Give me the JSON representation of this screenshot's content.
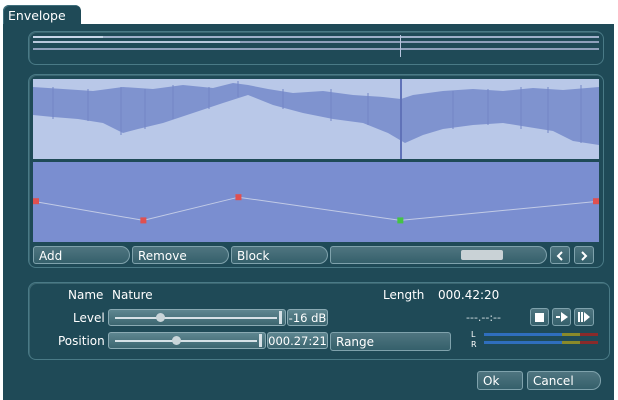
{
  "tab": {
    "label": "Envelope"
  },
  "buttons": {
    "add": "Add",
    "remove": "Remove",
    "block": "Block",
    "range": "Range",
    "ok": "Ok",
    "cancel": "Cancel"
  },
  "info": {
    "name_label": "Name",
    "name_value": "Nature",
    "length_label": "Length",
    "length_value": "000.42:20",
    "time_display": "---.--:--"
  },
  "controls": {
    "level_label": "Level",
    "level_value": "-16 dB",
    "level_fraction": 0.27,
    "position_label": "Position",
    "position_value": "000.27:21",
    "position_fraction": 0.43
  },
  "meters": {
    "left_label": "L",
    "right_label": "R"
  },
  "envelope": {
    "points": [
      {
        "t": 0.0,
        "level": 0.51,
        "color": "#e05050"
      },
      {
        "t": 0.195,
        "level": 0.27,
        "color": "#e05050"
      },
      {
        "t": 0.363,
        "level": 0.56,
        "color": "#e05050"
      },
      {
        "t": 0.649,
        "level": 0.27,
        "color": "#44c444"
      },
      {
        "t": 1.0,
        "level": 0.51,
        "color": "#e05050"
      }
    ]
  },
  "icons": {
    "transport": [
      "stop-icon",
      "play-icon",
      "play-selection-icon"
    ],
    "nav": [
      "chevron-left-icon",
      "chevron-right-icon"
    ]
  },
  "colors": {
    "window": "#1f4a57",
    "waveform": "#7f93cf",
    "envelope_bg": "#7a8ed0",
    "meter": "#2f6ebd"
  }
}
